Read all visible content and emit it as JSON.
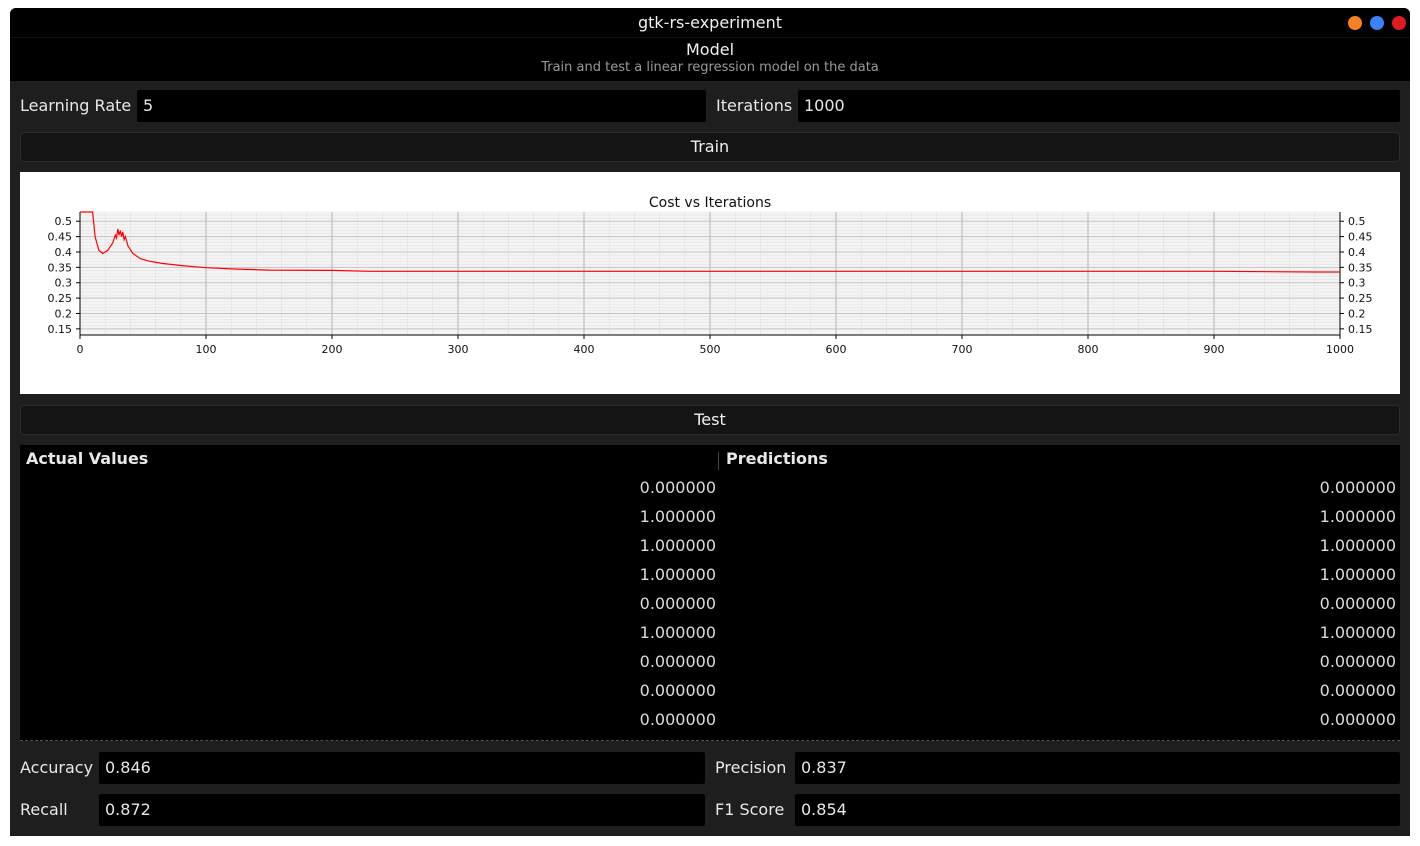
{
  "window": {
    "title": "gtk-rs-experiment",
    "controls": {
      "minimize_color": "#f58220",
      "maximize_color": "#3b82f6",
      "close_color": "#e01b24"
    }
  },
  "header": {
    "title": "Model",
    "subtitle": "Train and test a linear regression model on the data"
  },
  "params": {
    "learning_rate_label": "Learning Rate",
    "learning_rate_value": "5",
    "iterations_label": "Iterations",
    "iterations_value": "1000"
  },
  "buttons": {
    "train": "Train",
    "test": "Test"
  },
  "chart_data": {
    "type": "line",
    "title": "Cost vs Iterations",
    "xlabel": "",
    "ylabel": "",
    "xlim": [
      0,
      1000
    ],
    "ylim": [
      0.13,
      0.53
    ],
    "x_ticks": [
      0,
      100,
      200,
      300,
      400,
      500,
      600,
      700,
      800,
      900,
      1000
    ],
    "y_ticks": [
      0.15,
      0.2,
      0.25,
      0.3,
      0.35,
      0.4,
      0.45,
      0.5
    ],
    "y_tick_labels": [
      "0.15",
      "0.2",
      "0.25",
      "0.3",
      "0.35",
      "0.4",
      "0.45",
      "0.5"
    ],
    "grid": true,
    "series": [
      {
        "color": "#ff0000",
        "x": [
          0,
          10,
          12,
          15,
          18,
          22,
          26,
          28,
          29,
          30,
          31,
          32,
          33,
          34,
          35,
          36,
          38,
          42,
          48,
          55,
          65,
          80,
          100,
          120,
          150,
          200,
          230,
          300,
          500,
          700,
          900,
          980,
          1000
        ],
        "y": [
          0.53,
          0.53,
          0.45,
          0.405,
          0.395,
          0.405,
          0.43,
          0.455,
          0.445,
          0.475,
          0.455,
          0.47,
          0.45,
          0.465,
          0.44,
          0.45,
          0.42,
          0.395,
          0.378,
          0.37,
          0.363,
          0.356,
          0.349,
          0.345,
          0.341,
          0.34,
          0.337,
          0.337,
          0.337,
          0.337,
          0.337,
          0.335,
          0.335
        ]
      }
    ]
  },
  "table": {
    "headers": [
      "Actual Values",
      "Predictions"
    ],
    "actual": [
      "0.000000",
      "1.000000",
      "1.000000",
      "1.000000",
      "0.000000",
      "1.000000",
      "0.000000",
      "0.000000",
      "0.000000"
    ],
    "predictions": [
      "0.000000",
      "1.000000",
      "1.000000",
      "1.000000",
      "0.000000",
      "1.000000",
      "0.000000",
      "0.000000",
      "0.000000"
    ]
  },
  "metrics": {
    "accuracy_label": "Accuracy",
    "accuracy_value": "0.846",
    "precision_label": "Precision",
    "precision_value": "0.837",
    "recall_label": "Recall",
    "recall_value": "0.872",
    "f1_label": "F1 Score",
    "f1_value": "0.854"
  }
}
